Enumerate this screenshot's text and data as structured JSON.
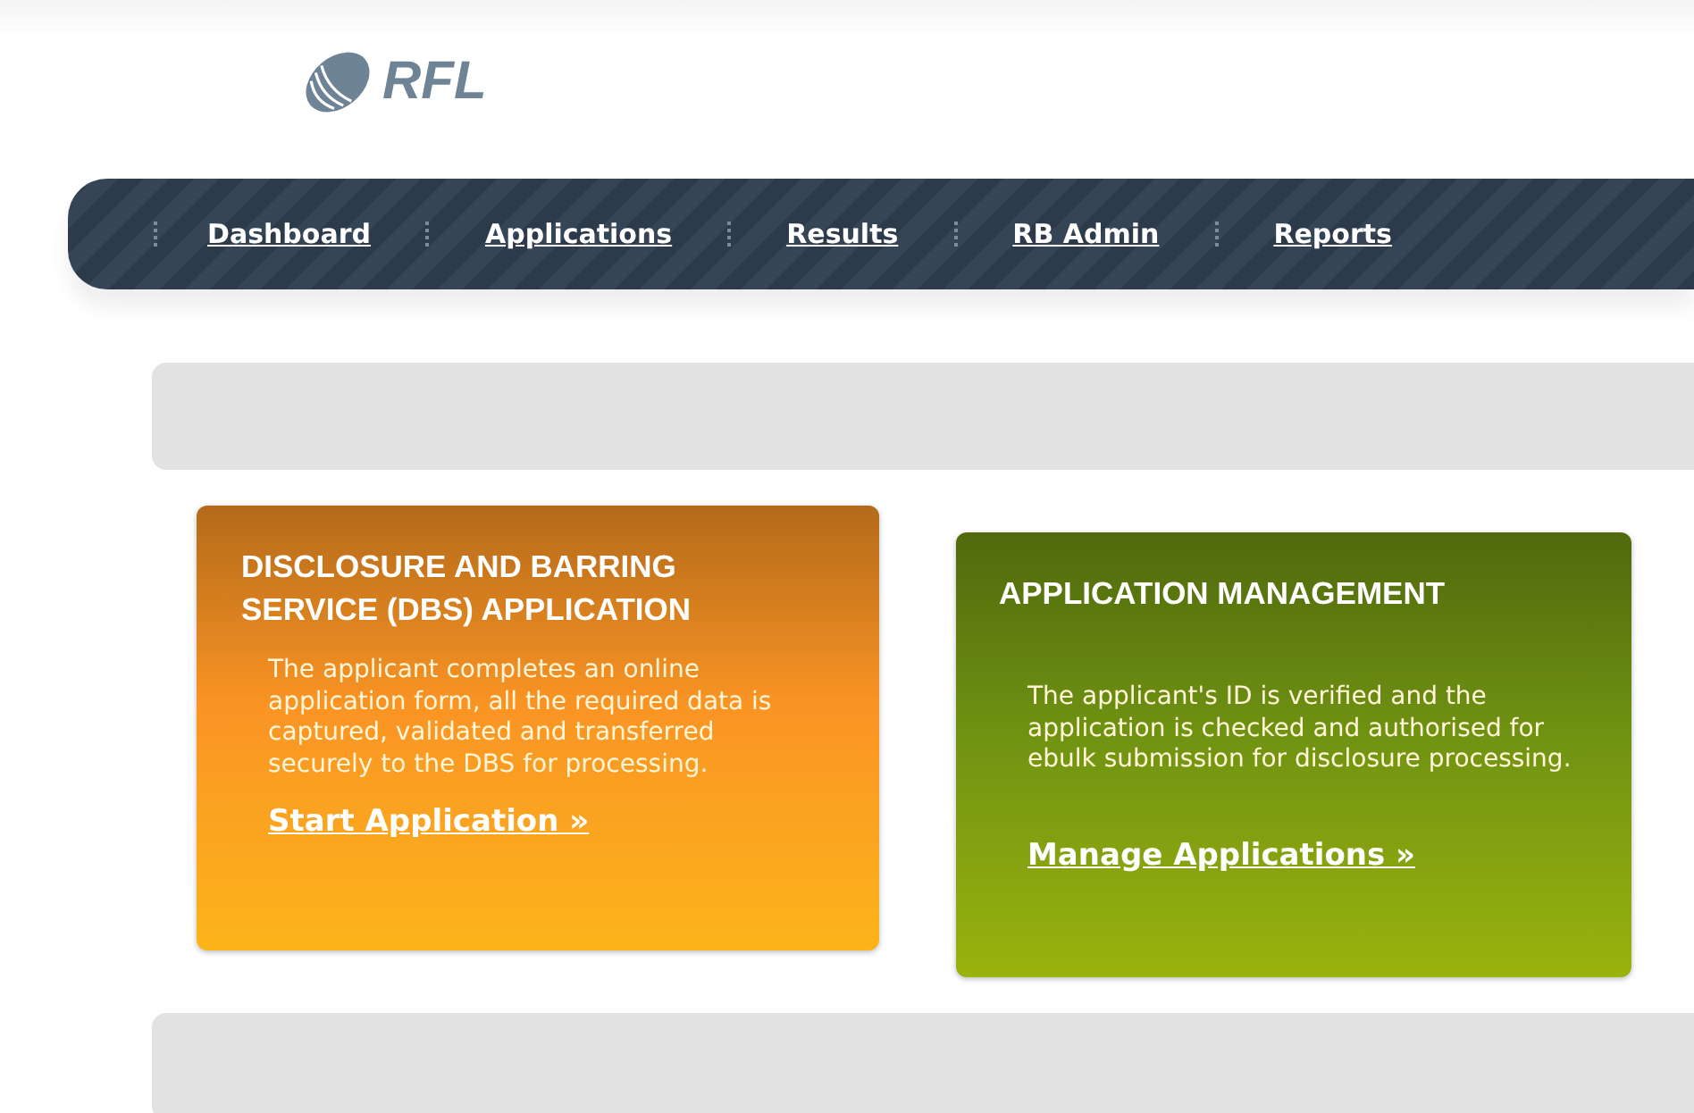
{
  "logo": {
    "text": "RFL"
  },
  "nav": [
    {
      "label": "Dashboard"
    },
    {
      "label": "Applications"
    },
    {
      "label": "Results"
    },
    {
      "label": "RB Admin"
    },
    {
      "label": "Reports"
    }
  ],
  "cards": [
    {
      "title": "DISCLOSURE AND BARRING SERVICE (DBS) APPLICATION",
      "text": "The applicant completes an online application form, all the required data is captured, validated and transferred securely to the DBS for processing.",
      "link": "Start Application »",
      "color": "#fa9424"
    },
    {
      "title": "APPLICATION MANAGEMENT",
      "text": "The applicant's ID is verified and the application is checked and authorised for ebulk submission for disclosure processing.",
      "link": "Manage Applications »",
      "color": "#6f9212"
    }
  ]
}
